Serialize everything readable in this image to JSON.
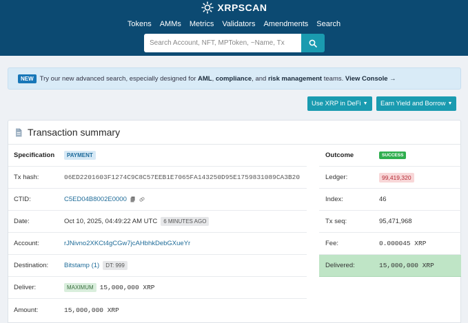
{
  "brand": {
    "name": "XRPSCAN"
  },
  "nav": {
    "items": [
      "Tokens",
      "AMMs",
      "Metrics",
      "Validators",
      "Amendments",
      "Search"
    ]
  },
  "search": {
    "placeholder": "Search Account, NFT, MPToken, ~Name, Tx"
  },
  "banner": {
    "badge": "NEW",
    "text_1": "Try our new advanced search, especially designed for",
    "kw_aml": "AML",
    "comma": ",",
    "kw_compliance": "compliance",
    "and": ", and",
    "kw_risk": "risk management",
    "text_2": "teams.",
    "cta": "View Console",
    "cta_arrow": "→"
  },
  "actions": {
    "use_xrp": "Use XRP in DeFi",
    "earn": "Earn Yield and Borrow"
  },
  "summary": {
    "title": "Transaction summary",
    "specification_label": "Specification",
    "specification_value": "PAYMENT",
    "rows": {
      "tx_hash": {
        "label": "Tx hash:",
        "value": "06ED2201603F1274C9C8C57EEB1E7065FA143250D95E1759831089CA3B20"
      },
      "ctid": {
        "label": "CTID:",
        "value": "C5ED04B8002E0000"
      },
      "date": {
        "label": "Date:",
        "value": "Oct 10, 2025, 04:49:22 AM UTC",
        "badge": "6 MINUTES AGO"
      },
      "account": {
        "label": "Account:",
        "value": "rJNivno2XKCt4gCGw7jcAHbhkDebGXueYr"
      },
      "destination": {
        "label": "Destination:",
        "value": "Bitstamp (1)",
        "badge": "DT: 999"
      },
      "deliver": {
        "label": "Deliver:",
        "badge": "MAXIMUM",
        "value": "15,000,000 XRP"
      },
      "amount": {
        "label": "Amount:",
        "value": "15,000,000 XRP"
      }
    }
  },
  "outcome": {
    "label": "Outcome",
    "status": "SUCCESS",
    "rows": {
      "ledger": {
        "label": "Ledger:",
        "value": "99,419,320"
      },
      "index": {
        "label": "Index:",
        "value": "46"
      },
      "tx_seq": {
        "label": "Tx seq:",
        "value": "95,471,968"
      },
      "fee": {
        "label": "Fee:",
        "value": "0.000045 XRP"
      },
      "delivered": {
        "label": "Delivered:",
        "value": "15,000,000 XRP"
      }
    }
  },
  "colors": {
    "header": "#0c4a72",
    "accent": "#1a9bb0",
    "success": "#2fae4e",
    "delivered_bg": "#bfe5c6"
  }
}
